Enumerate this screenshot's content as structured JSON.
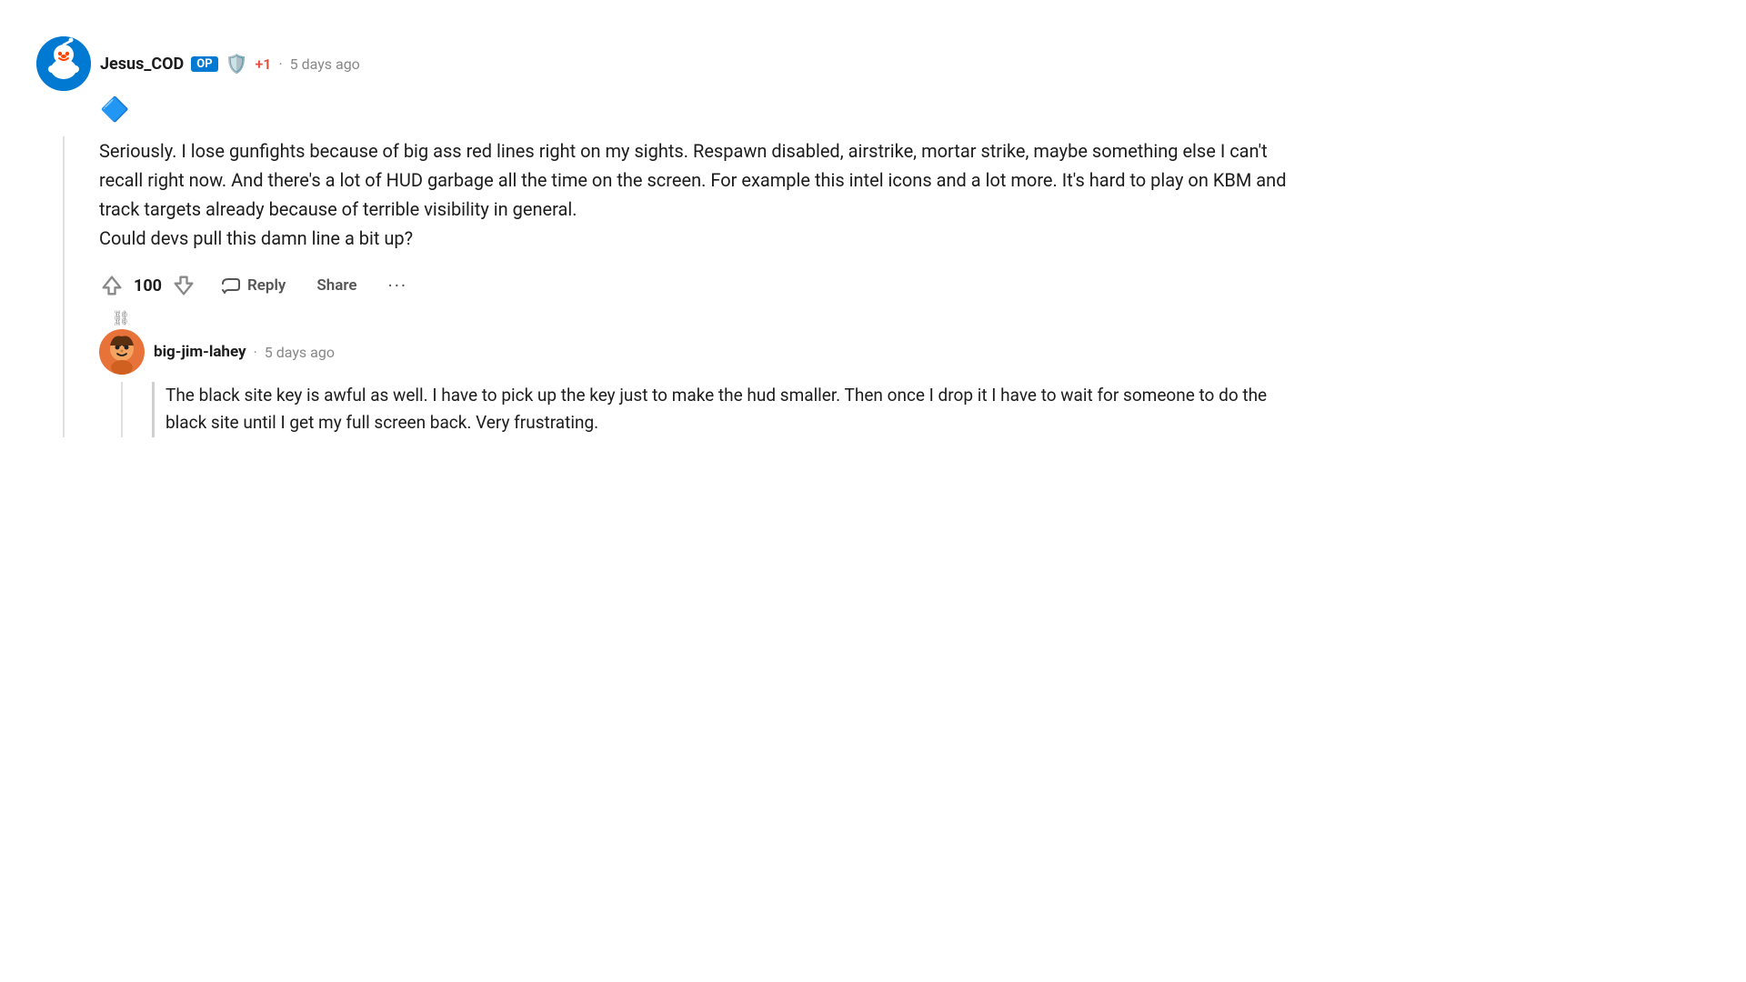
{
  "colors": {
    "background": "#ffffff",
    "text_primary": "#1c1c1c",
    "text_secondary": "#888888",
    "op_badge_bg": "#0079d3",
    "op_badge_text": "#ffffff",
    "karma_positive": "#e74c3c",
    "thread_line": "#e0e0e0",
    "avatar_reddit": "#0079d3",
    "avatar_user": "#e8733a"
  },
  "main_comment": {
    "username": "Jesus_COD",
    "op_badge": "OP",
    "award_emoji": "🛡️",
    "karma": "+1",
    "dot": "·",
    "timestamp": "5 days ago",
    "award_small": "🔷",
    "text_line1": "Seriously. I lose gunfights because of big ass red lines right on my sights. Respawn disabled,",
    "text_line2": "airstrike, mortar strike, maybe something else I can't recall right now. And there's a lot of HUD",
    "text_line3": "garbage all the time on the screen. For example this intel icons and a lot more. It's hard to play",
    "text_line4": "on KBM and track targets already because of terrible visibility in general.",
    "text_line5": "Could devs pull this damn line a bit up?",
    "full_text": "Seriously. I lose gunfights because of big ass red lines right on my sights. Respawn disabled, airstrike, mortar strike, maybe something else I can't recall right now. And there's a lot of HUD garbage all the time on the screen. For example this intel icons and a lot more. It's hard to play on KBM and track targets already because of terrible visibility in general.\nCould devs pull this damn line a bit up?",
    "vote_count": "100",
    "reply_label": "Reply",
    "share_label": "Share",
    "more_label": "···"
  },
  "sub_comment": {
    "username": "big-jim-lahey",
    "dot": "·",
    "timestamp": "5 days ago",
    "text": "The black site key is awful as well. I have to pick up the key just to make the hud smaller. Then once I drop it I have to wait for someone to do the black site until I get my full screen back. Very frustrating."
  }
}
